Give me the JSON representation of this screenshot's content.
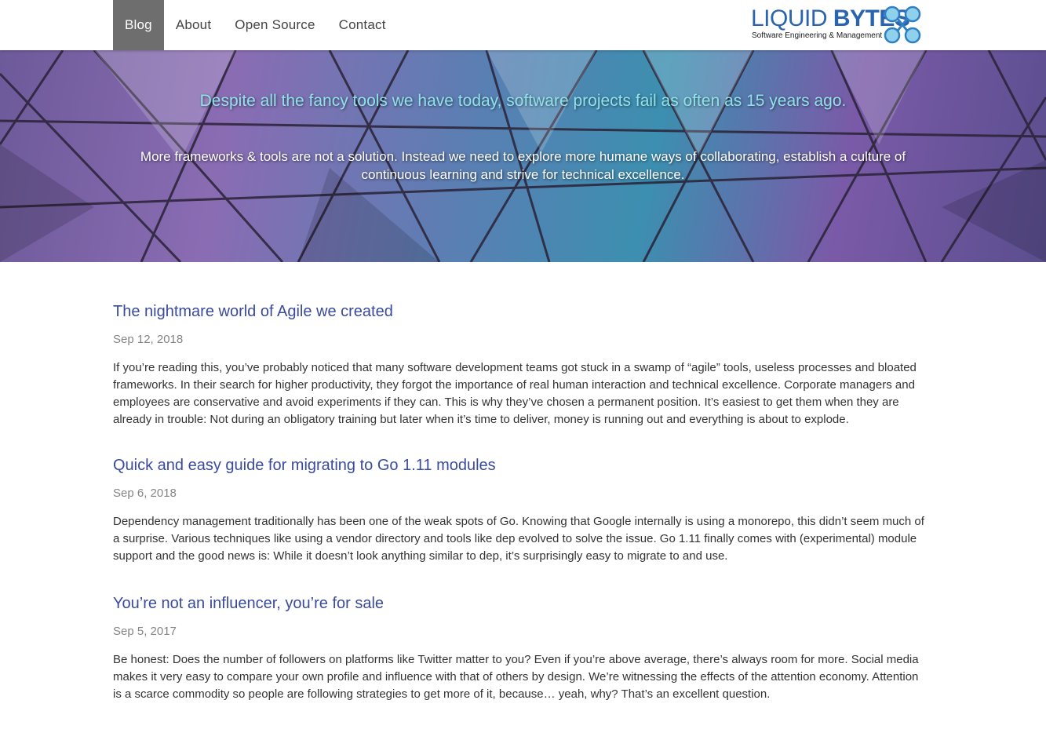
{
  "nav": {
    "items": [
      {
        "label": "Blog",
        "active": true
      },
      {
        "label": "About",
        "active": false
      },
      {
        "label": "Open Source",
        "active": false
      },
      {
        "label": "Contact",
        "active": false
      }
    ]
  },
  "logo": {
    "title_bold": "LIQUID",
    "title_rest": " BYTES",
    "subtitle": "Software Engineering & Management"
  },
  "hero": {
    "title": "Despite all the fancy tools we have today, software projects fail as often as 15 years ago.",
    "text": "More frameworks & tools are not a solution. Instead we need to explore more humane ways of collaborating, establish a culture of continuous learning and strive for technical excellence."
  },
  "posts": [
    {
      "title": "The nightmare world of Agile we created",
      "date": "Sep 12, 2018",
      "excerpt": "If you’re reading this, you’ve probably noticed that many software development teams got stuck in a swamp of “agile” tools, useless processes and bloated frameworks. In their search for higher productivity, they forgot the importance of real human interaction and technical excellence. Corporate managers and employees are conservative and avoid experiments if they can. This is why they’ve chosen a permanent position. It’s easiest to get them when they are already in trouble: Not during an obligatory training but later when it’s time to deliver, money is running out and everything is about to explode."
    },
    {
      "title": "Quick and easy guide for migrating to Go 1.11 modules",
      "date": "Sep 6, 2018",
      "excerpt": "Dependency management traditionally has been one of the weak spots of Go. Knowing that Google internally is using a monorepo, this didn’t seem much of a surprise. Various techniques like using a vendor directory and tools like dep evolved to solve the issue. Go 1.11 finally comes with (experimental) module support and the good news is: While it doesn’t look anything similar to dep, it’s surprisingly easy to migrate to and use."
    },
    {
      "title": "You’re not an influencer, you’re for sale",
      "date": "Sep 5, 2017",
      "excerpt": "Be honest: Does the number of followers on platforms like Twitter matter to you? Even if you’re above average, there’s always room for more. Social media makes it very easy to compare your own profile and influence with that of others by design. We’re witnessing the effects of the attention economy. Attention is a scarce commodity so people are following strategies to get more of it, because… yeah, why? That’s an excellent question."
    }
  ],
  "colors": {
    "nav_active_bg": "#6e6e6e",
    "link": "#3a4a9e",
    "hero_title": "#8fe3ea",
    "logo_blue": "#2a64b0"
  }
}
